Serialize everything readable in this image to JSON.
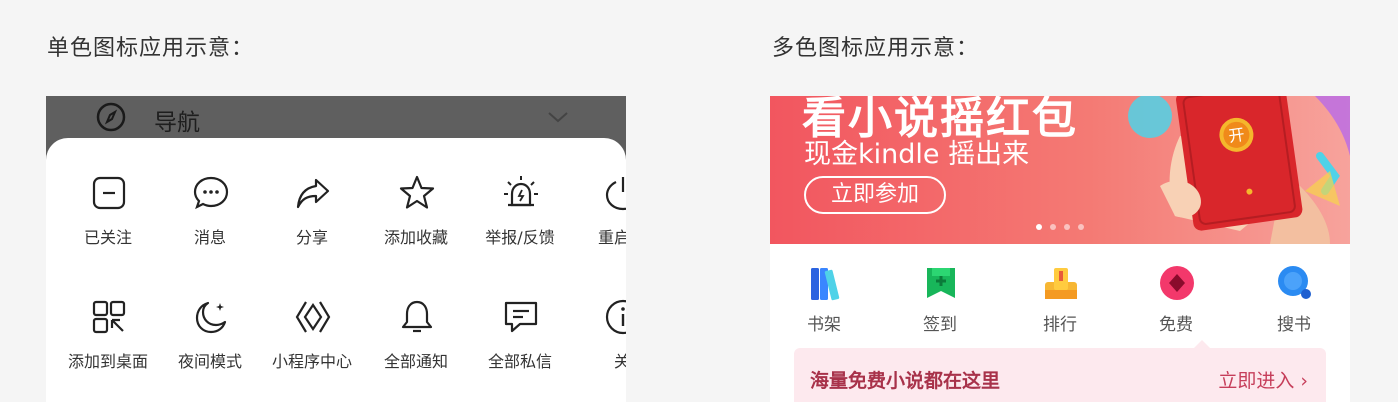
{
  "titles": {
    "mono": "单色图标应用示意：",
    "multi": "多色图标应用示意："
  },
  "mono": {
    "nav": {
      "label": "导航"
    },
    "row1": [
      "已关注",
      "消息",
      "分享",
      "添加收藏",
      "举报/反馈",
      "重启小"
    ],
    "row2": [
      "添加到桌面",
      "夜间模式",
      "小程序中心",
      "全部通知",
      "全部私信",
      "关"
    ]
  },
  "multi": {
    "banner": {
      "title": "看小说摇红包",
      "subtitle": "现金kindle 摇出来",
      "button": "立即参加",
      "envelope_char": "开"
    },
    "apps": [
      "书架",
      "签到",
      "排行",
      "免费",
      "搜书"
    ],
    "promo": {
      "text": "海量免费小说都在这里",
      "link": "立即进入 ›"
    }
  }
}
